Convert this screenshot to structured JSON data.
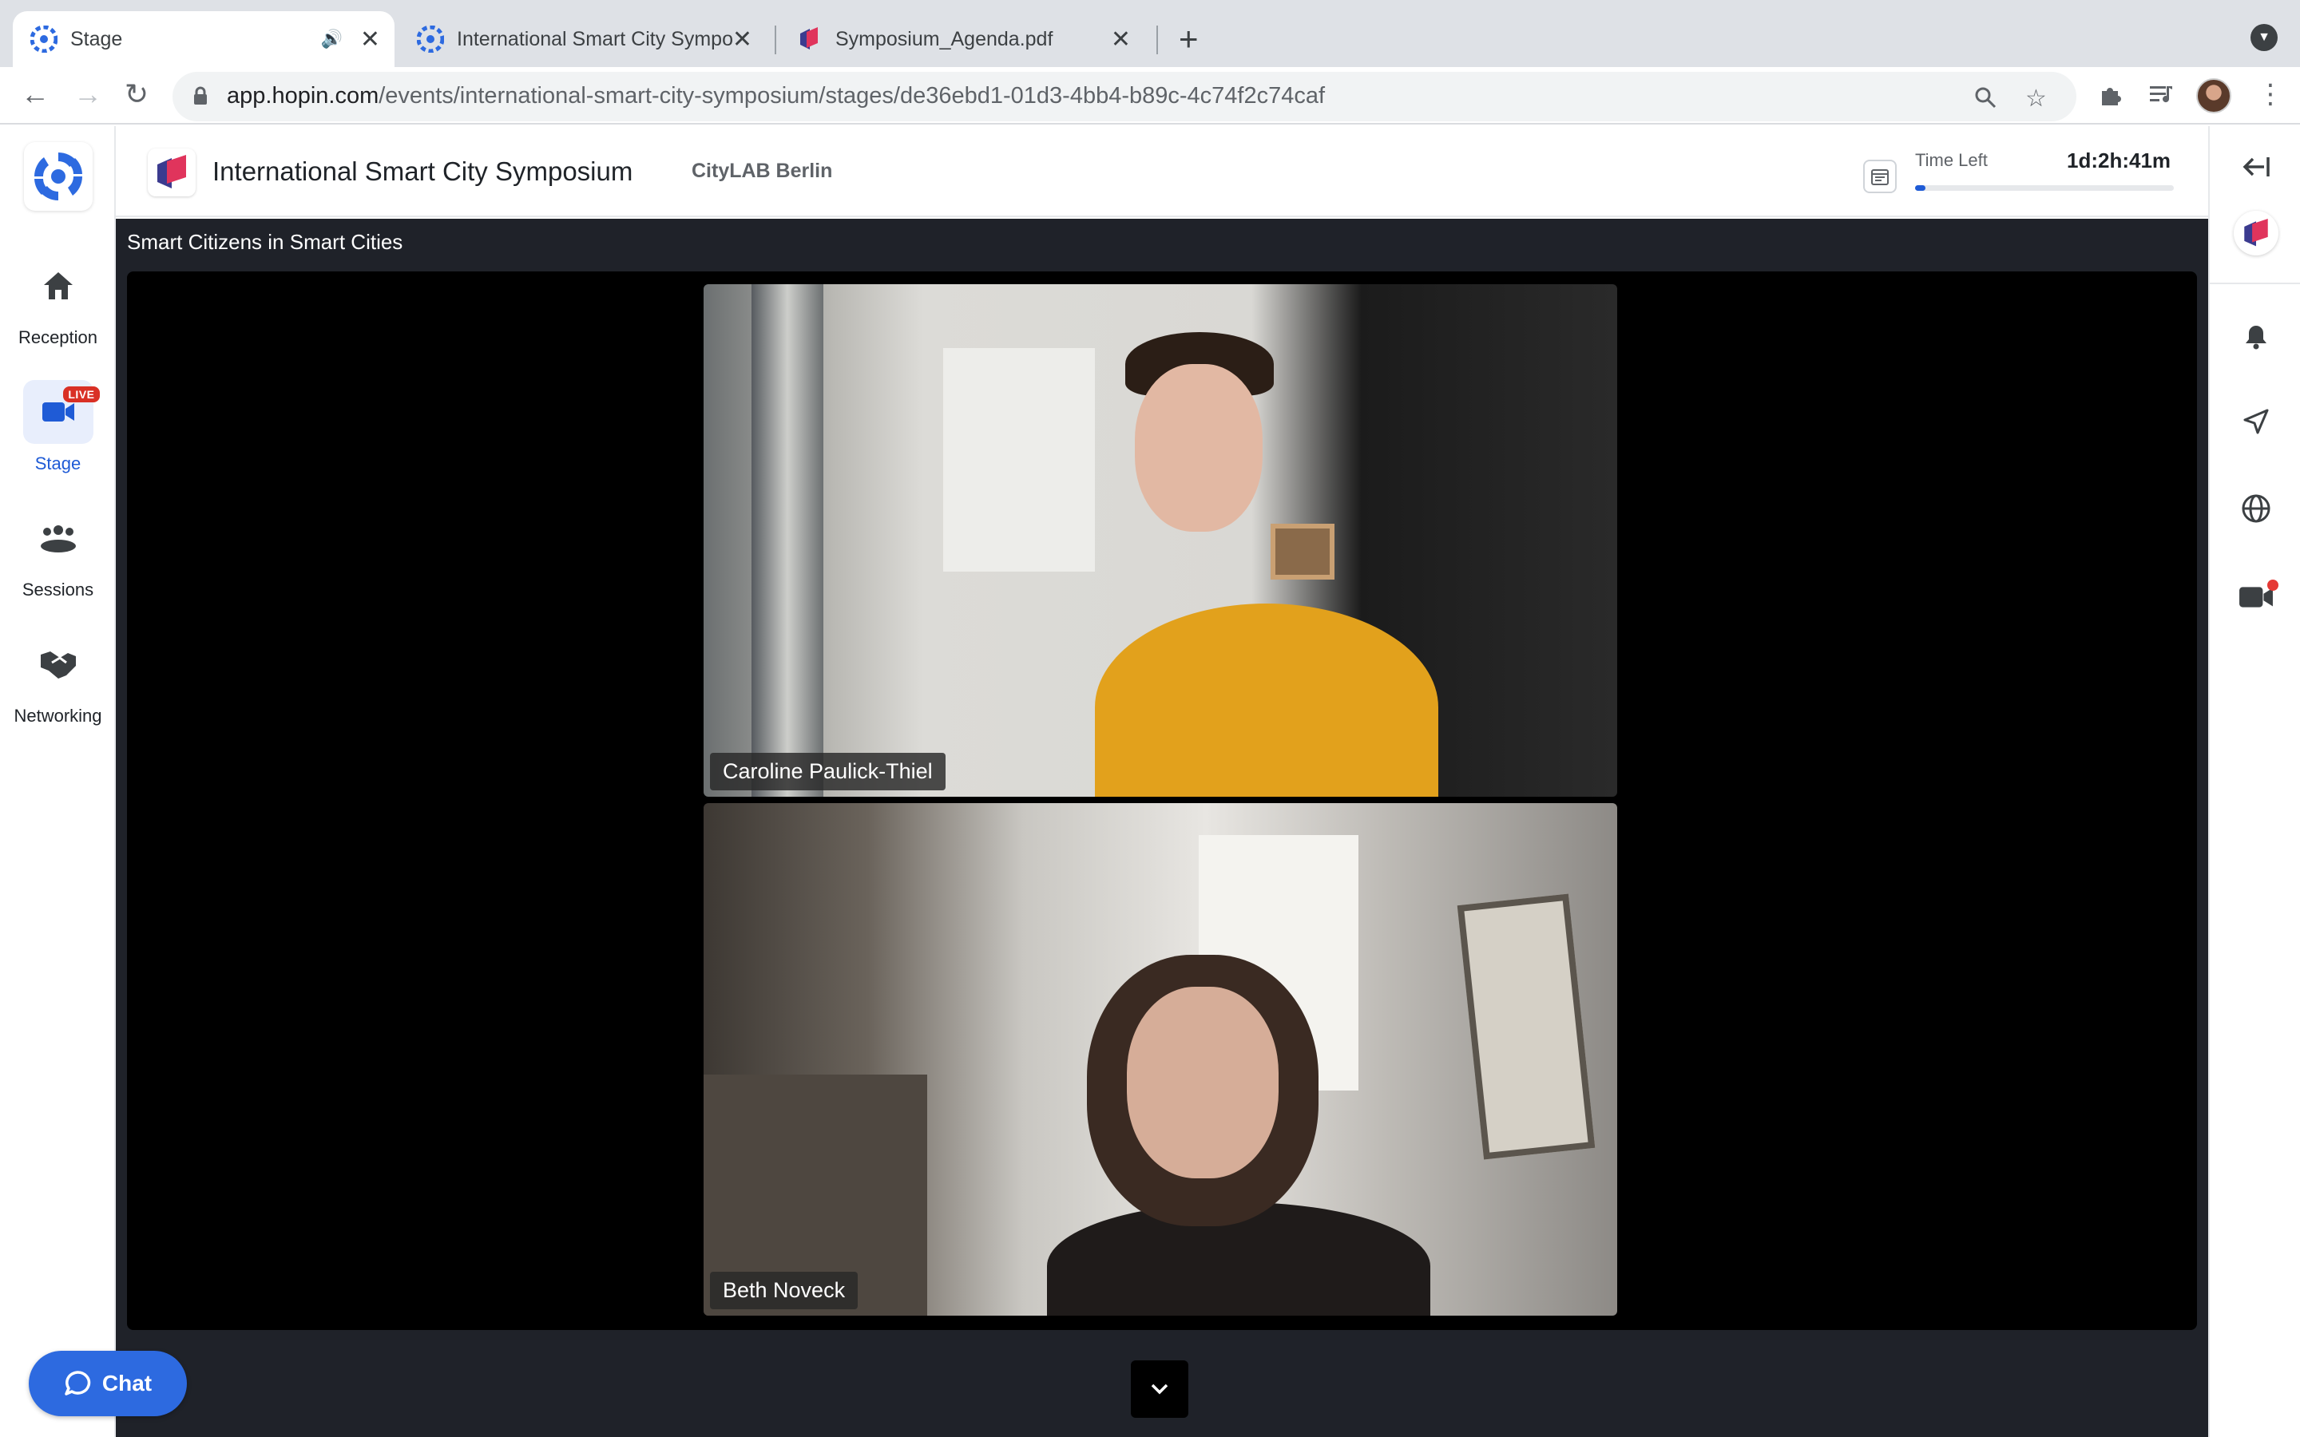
{
  "browser": {
    "tabs": [
      {
        "title": "Stage",
        "active": true,
        "audio": true
      },
      {
        "title": "International Smart City Symposium",
        "active": false
      },
      {
        "title": "Symposium_Agenda.pdf",
        "active": false
      }
    ],
    "url_host": "app.hopin.com",
    "url_path": "/events/international-smart-city-symposium/stages/de36ebd1-01d3-4bb4-b89c-4c74f2c74caf"
  },
  "nav": {
    "items": [
      {
        "label": "Reception",
        "icon": "home-icon"
      },
      {
        "label": "Stage",
        "icon": "video-camera-icon",
        "badge": "LIVE",
        "active": true
      },
      {
        "label": "Sessions",
        "icon": "people-group-icon"
      },
      {
        "label": "Networking",
        "icon": "handshake-icon"
      }
    ]
  },
  "event": {
    "title": "International Smart City Symposium",
    "organizer": "CityLAB Berlin",
    "time_left_label": "Time Left",
    "time_left_value": "1d:2h:41m",
    "time_progress": 0.04
  },
  "stage": {
    "session_title": "Smart Citizens in Smart Cities",
    "speakers": [
      {
        "name": "Caroline Paulick-Thiel"
      },
      {
        "name": "Beth Noveck"
      }
    ]
  },
  "chat": {
    "label": "Chat"
  },
  "colors": {
    "accent": "#2d6ae0",
    "stage_bg": "#1f2229",
    "live": "#d93025"
  }
}
